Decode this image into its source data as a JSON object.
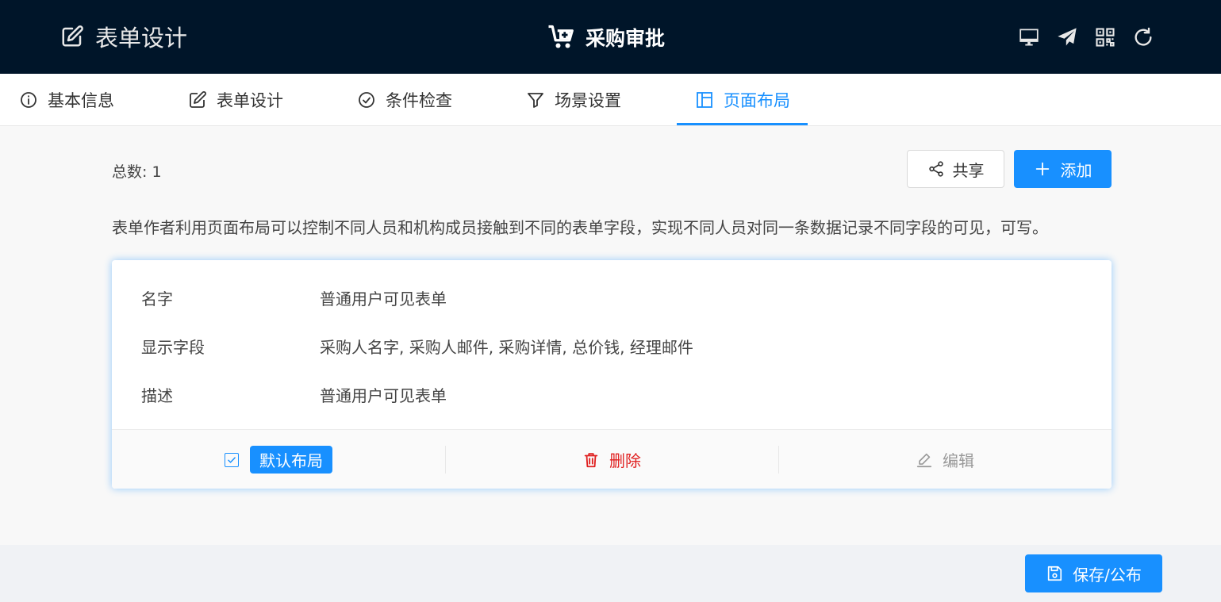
{
  "header": {
    "left_title": "表单设计",
    "center_title": "采购审批",
    "icons": [
      "desktop-icon",
      "send-icon",
      "qrcode-icon",
      "refresh-icon"
    ]
  },
  "tabs": [
    {
      "label": "基本信息",
      "icon": "info-icon",
      "active": false
    },
    {
      "label": "表单设计",
      "icon": "edit-icon",
      "active": false
    },
    {
      "label": "条件检查",
      "icon": "check-circle-icon",
      "active": false
    },
    {
      "label": "场景设置",
      "icon": "filter-icon",
      "active": false
    },
    {
      "label": "页面布局",
      "icon": "layout-icon",
      "active": true
    }
  ],
  "toolbar": {
    "total_text": "总数: 1",
    "share_label": "共享",
    "add_label": "添加"
  },
  "description": "表单作者利用页面布局可以控制不同人员和机构成员接触到不同的表单字段，实现不同人员对同一条数据记录不同字段的可见，可写。",
  "card": {
    "rows": [
      {
        "label": "名字",
        "value": "普通用户可见表单"
      },
      {
        "label": "显示字段",
        "value": "采购人名字, 采购人邮件, 采购详情, 总价钱, 经理邮件"
      },
      {
        "label": "描述",
        "value": "普通用户可见表单"
      }
    ],
    "actions": {
      "default_layout_label": "默认布局",
      "default_checked": true,
      "delete_label": "删除",
      "edit_label": "编辑"
    }
  },
  "footer": {
    "save_label": "保存/公布"
  },
  "colors": {
    "header_bg": "#001529",
    "primary": "#1890ff",
    "danger": "#e02020",
    "muted": "#999999"
  }
}
